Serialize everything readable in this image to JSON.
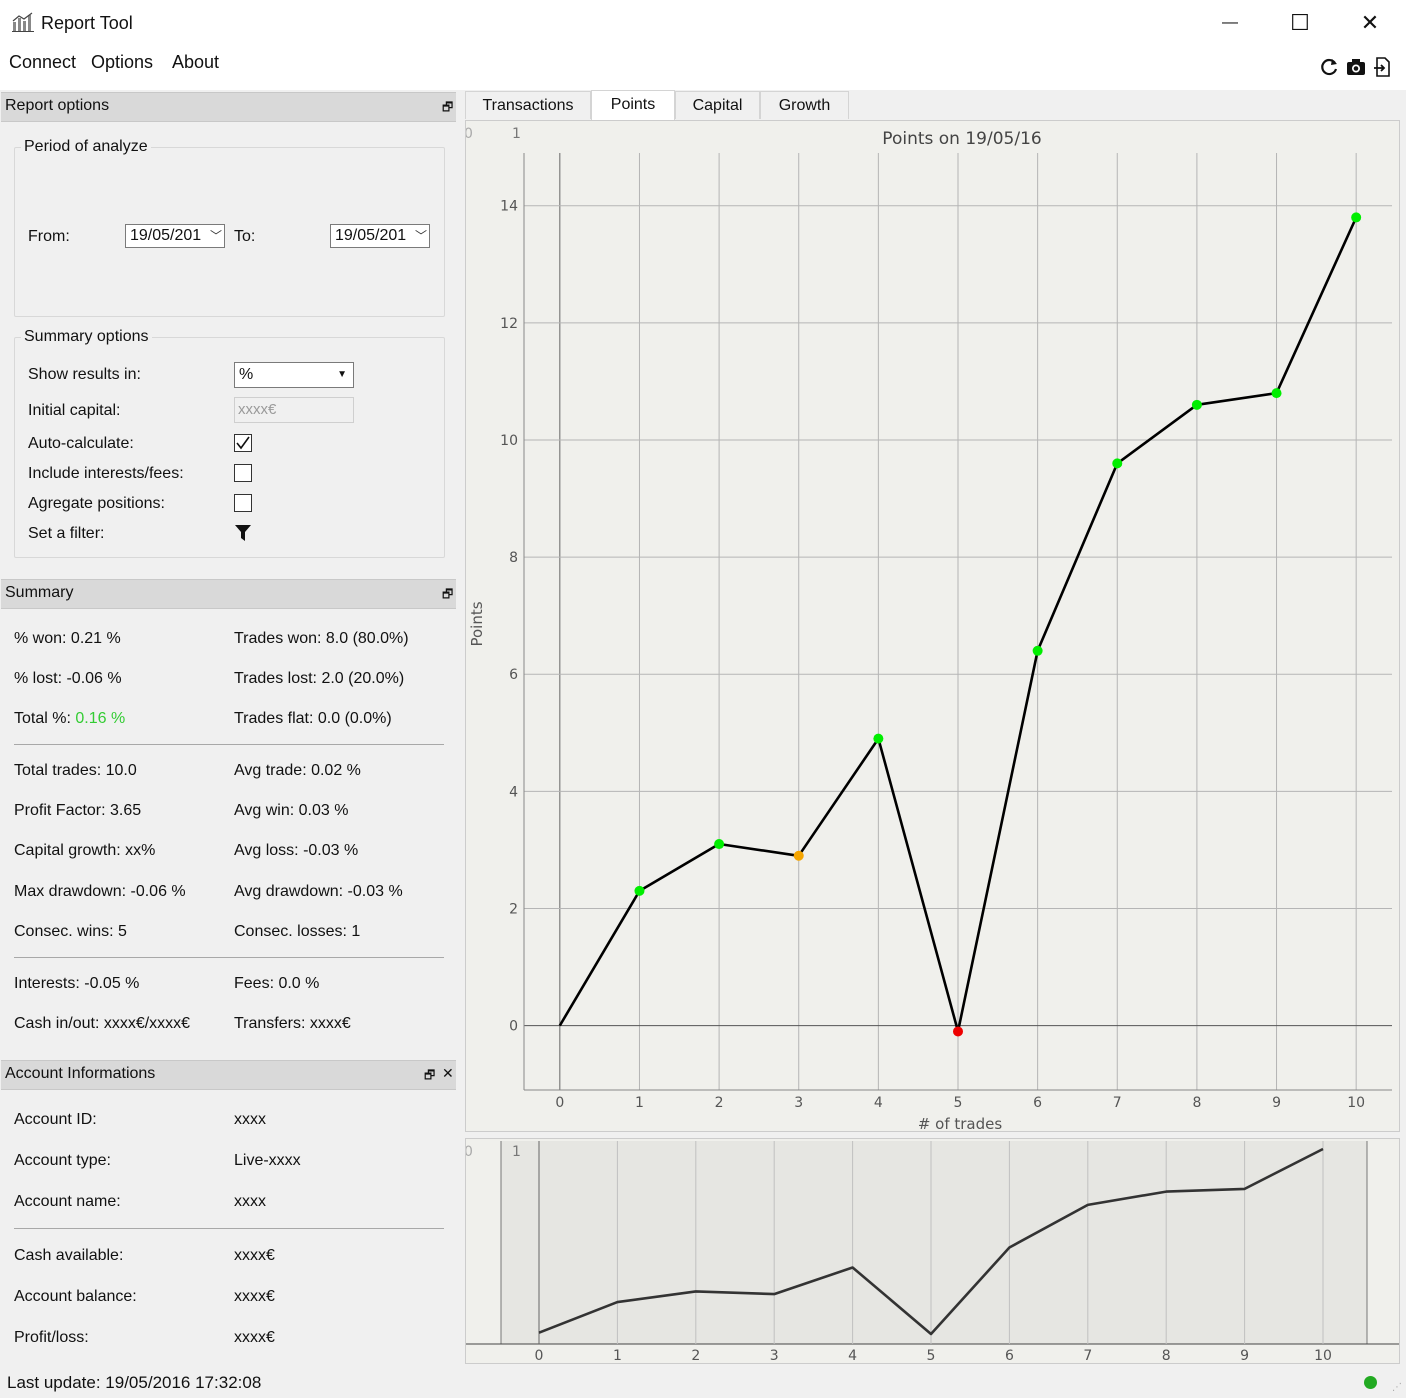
{
  "window": {
    "title": "Report Tool",
    "icon": "chart-app-icon",
    "minimize_glyph": "—",
    "maximize_glyph": "☐",
    "close_glyph": "✕"
  },
  "menu": {
    "items": [
      "Connect",
      "Options",
      "About"
    ]
  },
  "toolbar": {
    "icons": [
      "refresh-icon",
      "camera-icon",
      "export-icon"
    ]
  },
  "report_options": {
    "header": "Report options",
    "period": {
      "title": "Period of analyze",
      "from_label": "From:",
      "from_value": "19/05/201",
      "to_label": "To:",
      "to_value": "19/05/201"
    },
    "summary_options": {
      "title": "Summary options",
      "show_results_label": "Show results in:",
      "show_results_value": "%",
      "initial_capital_label": "Initial capital:",
      "initial_capital_placeholder": "xxxx€",
      "auto_calculate_label": "Auto-calculate:",
      "auto_calculate_checked": true,
      "include_interests_label": "Include interests/fees:",
      "include_interests_checked": false,
      "aggregate_label": "Agregate positions:",
      "aggregate_checked": false,
      "filter_label": "Set a filter:"
    }
  },
  "summary": {
    "header": "Summary",
    "won_pct": "% won: 0.21 %",
    "lost_pct": "% lost: -0.06 %",
    "total_pct_label": "Total %:",
    "total_pct_value": "0.16 %",
    "trades_won": "Trades won: 8.0 (80.0%)",
    "trades_lost": "Trades lost: 2.0 (20.0%)",
    "trades_flat": "Trades flat: 0.0 (0.0%)",
    "total_trades": "Total trades: 10.0",
    "profit_factor": "Profit Factor: 3.65",
    "capital_growth": "Capital growth: xx%",
    "max_drawdown": "Max drawdown: -0.06 %",
    "consec_wins": "Consec. wins: 5",
    "avg_trade": "Avg trade: 0.02 %",
    "avg_win": "Avg win: 0.03 %",
    "avg_loss": "Avg loss: -0.03 %",
    "avg_drawdown": "Avg drawdown: -0.03 %",
    "consec_losses": "Consec. losses: 1",
    "interests": "Interests: -0.05 %",
    "cash_inout": "Cash in/out: xxxx€/xxxx€",
    "fees": "Fees: 0.0 %",
    "transfers": "Transfers: xxxx€"
  },
  "account": {
    "header": "Account Informations",
    "id_label": "Account ID:",
    "id_value": "xxxx",
    "type_label": "Account type:",
    "type_value": "Live-xxxx",
    "name_label": "Account name:",
    "name_value": "xxxx",
    "cash_label": "Cash available:",
    "cash_value": "xxxx€",
    "balance_label": "Account balance:",
    "balance_value": "xxxx€",
    "pl_label": "Profit/loss:",
    "pl_value": "xxxx€"
  },
  "status": {
    "last_update": "Last update: 19/05/2016 17:32:08",
    "indicator_color": "#22aa22"
  },
  "tabs": [
    {
      "label": "Transactions",
      "active": false
    },
    {
      "label": "Points",
      "active": true
    },
    {
      "label": "Capital",
      "active": false
    },
    {
      "label": "Growth",
      "active": false
    }
  ],
  "colors": {
    "win": "#00ee00",
    "flat": "#f5a500",
    "loss": "#ee0000",
    "green_text": "#33cc33"
  },
  "chart_data": {
    "type": "line",
    "title": "Points on 19/05/16",
    "xlabel": "# of trades",
    "ylabel": "Points",
    "corner_labels": [
      "0",
      "1"
    ],
    "x": [
      0,
      1,
      2,
      3,
      4,
      5,
      6,
      7,
      8,
      9,
      10
    ],
    "y": [
      0,
      2.3,
      3.1,
      2.9,
      4.9,
      -0.1,
      6.4,
      9.6,
      10.6,
      10.8,
      13.8
    ],
    "point_status": [
      null,
      "win",
      "win",
      "flat",
      "win",
      "loss",
      "win",
      "win",
      "win",
      "win",
      "win"
    ],
    "xticks": [
      0,
      1,
      2,
      3,
      4,
      5,
      6,
      7,
      8,
      9,
      10
    ],
    "yticks": [
      0,
      2,
      4,
      6,
      8,
      10,
      12,
      14
    ],
    "xlim": [
      -0.45,
      10.45
    ],
    "ylim": [
      -1.1,
      14.9
    ],
    "grid": true,
    "overview": {
      "type": "line",
      "corner_labels": [
        "0",
        "1"
      ],
      "xticks": [
        0,
        1,
        2,
        3,
        4,
        5,
        6,
        7,
        8,
        9,
        10
      ],
      "xlim": [
        -0.45,
        10.45
      ]
    }
  }
}
